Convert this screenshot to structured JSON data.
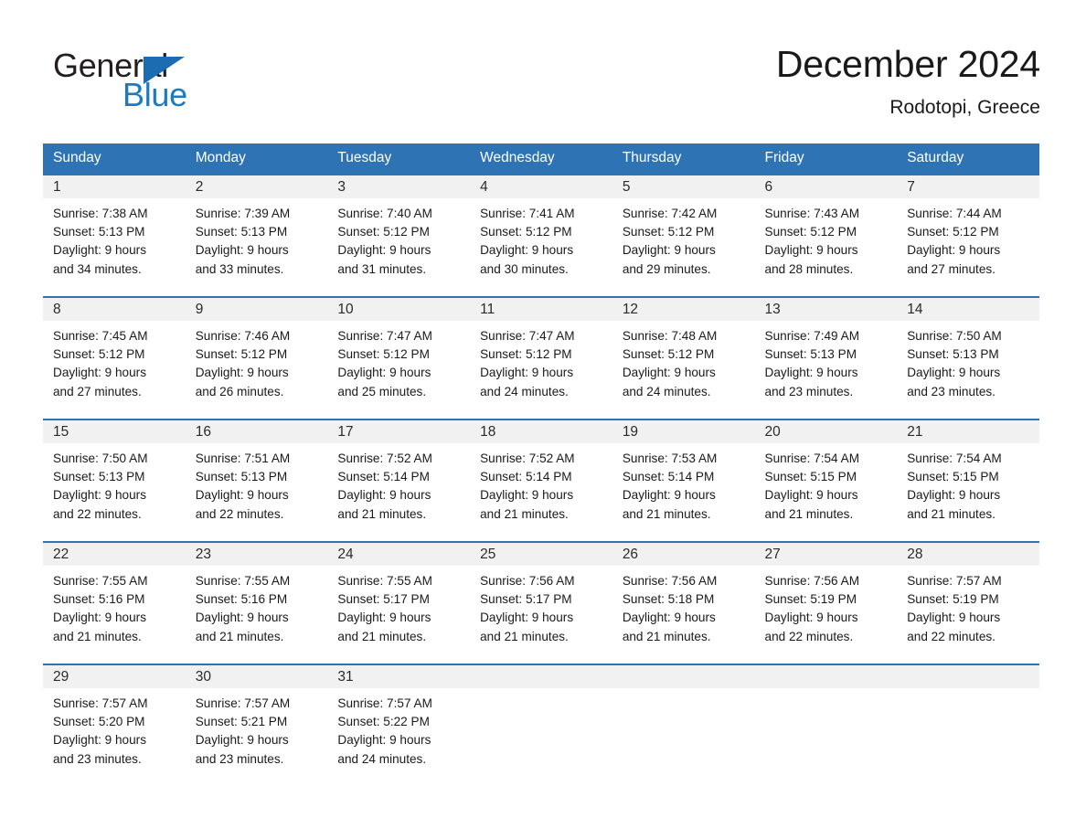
{
  "logo": {
    "word1": "General",
    "word2": "Blue",
    "triangle_color": "#1b6cb0",
    "blue_text_color": "#1b7ac4"
  },
  "header": {
    "title": "December 2024",
    "location": "Rodotopi, Greece",
    "header_bg": "#2e74b5",
    "band_bg": "#f1f1f1"
  },
  "weekdays": [
    "Sunday",
    "Monday",
    "Tuesday",
    "Wednesday",
    "Thursday",
    "Friday",
    "Saturday"
  ],
  "weeks": [
    [
      {
        "day": "1",
        "sunrise": "Sunrise: 7:38 AM",
        "sunset": "Sunset: 5:13 PM",
        "daylight1": "Daylight: 9 hours",
        "daylight2": "and 34 minutes."
      },
      {
        "day": "2",
        "sunrise": "Sunrise: 7:39 AM",
        "sunset": "Sunset: 5:13 PM",
        "daylight1": "Daylight: 9 hours",
        "daylight2": "and 33 minutes."
      },
      {
        "day": "3",
        "sunrise": "Sunrise: 7:40 AM",
        "sunset": "Sunset: 5:12 PM",
        "daylight1": "Daylight: 9 hours",
        "daylight2": "and 31 minutes."
      },
      {
        "day": "4",
        "sunrise": "Sunrise: 7:41 AM",
        "sunset": "Sunset: 5:12 PM",
        "daylight1": "Daylight: 9 hours",
        "daylight2": "and 30 minutes."
      },
      {
        "day": "5",
        "sunrise": "Sunrise: 7:42 AM",
        "sunset": "Sunset: 5:12 PM",
        "daylight1": "Daylight: 9 hours",
        "daylight2": "and 29 minutes."
      },
      {
        "day": "6",
        "sunrise": "Sunrise: 7:43 AM",
        "sunset": "Sunset: 5:12 PM",
        "daylight1": "Daylight: 9 hours",
        "daylight2": "and 28 minutes."
      },
      {
        "day": "7",
        "sunrise": "Sunrise: 7:44 AM",
        "sunset": "Sunset: 5:12 PM",
        "daylight1": "Daylight: 9 hours",
        "daylight2": "and 27 minutes."
      }
    ],
    [
      {
        "day": "8",
        "sunrise": "Sunrise: 7:45 AM",
        "sunset": "Sunset: 5:12 PM",
        "daylight1": "Daylight: 9 hours",
        "daylight2": "and 27 minutes."
      },
      {
        "day": "9",
        "sunrise": "Sunrise: 7:46 AM",
        "sunset": "Sunset: 5:12 PM",
        "daylight1": "Daylight: 9 hours",
        "daylight2": "and 26 minutes."
      },
      {
        "day": "10",
        "sunrise": "Sunrise: 7:47 AM",
        "sunset": "Sunset: 5:12 PM",
        "daylight1": "Daylight: 9 hours",
        "daylight2": "and 25 minutes."
      },
      {
        "day": "11",
        "sunrise": "Sunrise: 7:47 AM",
        "sunset": "Sunset: 5:12 PM",
        "daylight1": "Daylight: 9 hours",
        "daylight2": "and 24 minutes."
      },
      {
        "day": "12",
        "sunrise": "Sunrise: 7:48 AM",
        "sunset": "Sunset: 5:12 PM",
        "daylight1": "Daylight: 9 hours",
        "daylight2": "and 24 minutes."
      },
      {
        "day": "13",
        "sunrise": "Sunrise: 7:49 AM",
        "sunset": "Sunset: 5:13 PM",
        "daylight1": "Daylight: 9 hours",
        "daylight2": "and 23 minutes."
      },
      {
        "day": "14",
        "sunrise": "Sunrise: 7:50 AM",
        "sunset": "Sunset: 5:13 PM",
        "daylight1": "Daylight: 9 hours",
        "daylight2": "and 23 minutes."
      }
    ],
    [
      {
        "day": "15",
        "sunrise": "Sunrise: 7:50 AM",
        "sunset": "Sunset: 5:13 PM",
        "daylight1": "Daylight: 9 hours",
        "daylight2": "and 22 minutes."
      },
      {
        "day": "16",
        "sunrise": "Sunrise: 7:51 AM",
        "sunset": "Sunset: 5:13 PM",
        "daylight1": "Daylight: 9 hours",
        "daylight2": "and 22 minutes."
      },
      {
        "day": "17",
        "sunrise": "Sunrise: 7:52 AM",
        "sunset": "Sunset: 5:14 PM",
        "daylight1": "Daylight: 9 hours",
        "daylight2": "and 21 minutes."
      },
      {
        "day": "18",
        "sunrise": "Sunrise: 7:52 AM",
        "sunset": "Sunset: 5:14 PM",
        "daylight1": "Daylight: 9 hours",
        "daylight2": "and 21 minutes."
      },
      {
        "day": "19",
        "sunrise": "Sunrise: 7:53 AM",
        "sunset": "Sunset: 5:14 PM",
        "daylight1": "Daylight: 9 hours",
        "daylight2": "and 21 minutes."
      },
      {
        "day": "20",
        "sunrise": "Sunrise: 7:54 AM",
        "sunset": "Sunset: 5:15 PM",
        "daylight1": "Daylight: 9 hours",
        "daylight2": "and 21 minutes."
      },
      {
        "day": "21",
        "sunrise": "Sunrise: 7:54 AM",
        "sunset": "Sunset: 5:15 PM",
        "daylight1": "Daylight: 9 hours",
        "daylight2": "and 21 minutes."
      }
    ],
    [
      {
        "day": "22",
        "sunrise": "Sunrise: 7:55 AM",
        "sunset": "Sunset: 5:16 PM",
        "daylight1": "Daylight: 9 hours",
        "daylight2": "and 21 minutes."
      },
      {
        "day": "23",
        "sunrise": "Sunrise: 7:55 AM",
        "sunset": "Sunset: 5:16 PM",
        "daylight1": "Daylight: 9 hours",
        "daylight2": "and 21 minutes."
      },
      {
        "day": "24",
        "sunrise": "Sunrise: 7:55 AM",
        "sunset": "Sunset: 5:17 PM",
        "daylight1": "Daylight: 9 hours",
        "daylight2": "and 21 minutes."
      },
      {
        "day": "25",
        "sunrise": "Sunrise: 7:56 AM",
        "sunset": "Sunset: 5:17 PM",
        "daylight1": "Daylight: 9 hours",
        "daylight2": "and 21 minutes."
      },
      {
        "day": "26",
        "sunrise": "Sunrise: 7:56 AM",
        "sunset": "Sunset: 5:18 PM",
        "daylight1": "Daylight: 9 hours",
        "daylight2": "and 21 minutes."
      },
      {
        "day": "27",
        "sunrise": "Sunrise: 7:56 AM",
        "sunset": "Sunset: 5:19 PM",
        "daylight1": "Daylight: 9 hours",
        "daylight2": "and 22 minutes."
      },
      {
        "day": "28",
        "sunrise": "Sunrise: 7:57 AM",
        "sunset": "Sunset: 5:19 PM",
        "daylight1": "Daylight: 9 hours",
        "daylight2": "and 22 minutes."
      }
    ],
    [
      {
        "day": "29",
        "sunrise": "Sunrise: 7:57 AM",
        "sunset": "Sunset: 5:20 PM",
        "daylight1": "Daylight: 9 hours",
        "daylight2": "and 23 minutes."
      },
      {
        "day": "30",
        "sunrise": "Sunrise: 7:57 AM",
        "sunset": "Sunset: 5:21 PM",
        "daylight1": "Daylight: 9 hours",
        "daylight2": "and 23 minutes."
      },
      {
        "day": "31",
        "sunrise": "Sunrise: 7:57 AM",
        "sunset": "Sunset: 5:22 PM",
        "daylight1": "Daylight: 9 hours",
        "daylight2": "and 24 minutes."
      },
      {
        "day": "",
        "sunrise": "",
        "sunset": "",
        "daylight1": "",
        "daylight2": ""
      },
      {
        "day": "",
        "sunrise": "",
        "sunset": "",
        "daylight1": "",
        "daylight2": ""
      },
      {
        "day": "",
        "sunrise": "",
        "sunset": "",
        "daylight1": "",
        "daylight2": ""
      },
      {
        "day": "",
        "sunrise": "",
        "sunset": "",
        "daylight1": "",
        "daylight2": ""
      }
    ]
  ]
}
